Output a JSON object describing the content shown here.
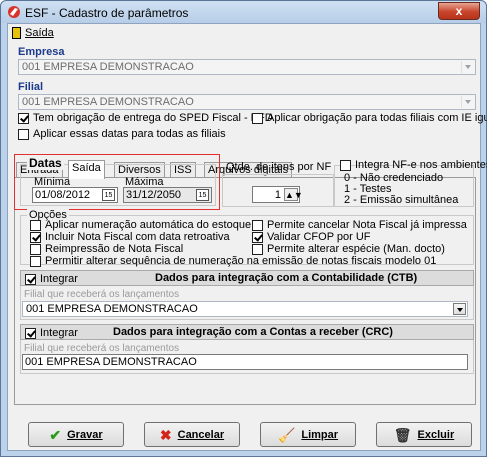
{
  "window": {
    "title": "ESF - Cadastro de parâmetros",
    "close_glyph": "x"
  },
  "menu": {
    "exit_label": "Saída"
  },
  "empresa": {
    "label": "Empresa",
    "value": "001 EMPRESA DEMONSTRACAO"
  },
  "filial": {
    "label": "Filial",
    "value": "001 EMPRESA DEMONSTRACAO"
  },
  "options_top": {
    "sped": "Tem obrigação de entrega do SPED Fiscal - EFD",
    "apply_ie": "Aplicar obrigação para todas filiais com IE iguais",
    "apply_dates": "Aplicar essas datas para todas as filiais"
  },
  "tabs": [
    "Entrada",
    "Saída",
    "Diversos",
    "ISS",
    "Arquivos digitais"
  ],
  "datas": {
    "title": "Datas",
    "min_label": "Mínima",
    "min_value": "01/08/2012",
    "max_label": "Máxima",
    "max_value": "31/12/2050",
    "cal_glyph": "15"
  },
  "qtd": {
    "label": "Qtde. de itens por NF",
    "value": "1"
  },
  "nfe": {
    "label": "Integra NF-e nos ambientes",
    "line1": "0 - Não credenciado",
    "line2": "1 - Testes",
    "line3": "2 - Emissão simultânea"
  },
  "opcoes": {
    "title": "Opções",
    "o1": "Aplicar numeração automática do estoque",
    "o2": "Incluir Nota Fiscal com data retroativa",
    "o3": "Reimpressão de Nota Fiscal",
    "o4": "Permitir alterar sequência de numeração na emissão de notas fiscais modelo 01",
    "o5": "Permite cancelar Nota Fiscal já impressa",
    "o6": "Validar CFOP por UF",
    "o7": "Permite alterar espécie (Man. docto)"
  },
  "ctb": {
    "integrar": "Integrar",
    "title": "Dados para integração com a Contabilidade (CTB)",
    "hint": "Filial que receberá os lançamentos",
    "value": "001 EMPRESA DEMONSTRACAO"
  },
  "crc": {
    "integrar": "Integrar",
    "title": "Dados para integração com a Contas a receber (CRC)",
    "hint": "Filial que receberá os lançamentos",
    "value": "001 EMPRESA DEMONSTRACAO"
  },
  "buttons": {
    "save": "Gravar",
    "cancel": "Cancelar",
    "clear": "Limpar",
    "delete": "Excluir"
  },
  "icons": {
    "save": "check-icon",
    "cancel": "x-icon",
    "clear": "broom-icon",
    "delete": "trash-icon"
  },
  "colors": {
    "accent_blue": "#1c3a8c",
    "highlight_red": "#e03030"
  }
}
